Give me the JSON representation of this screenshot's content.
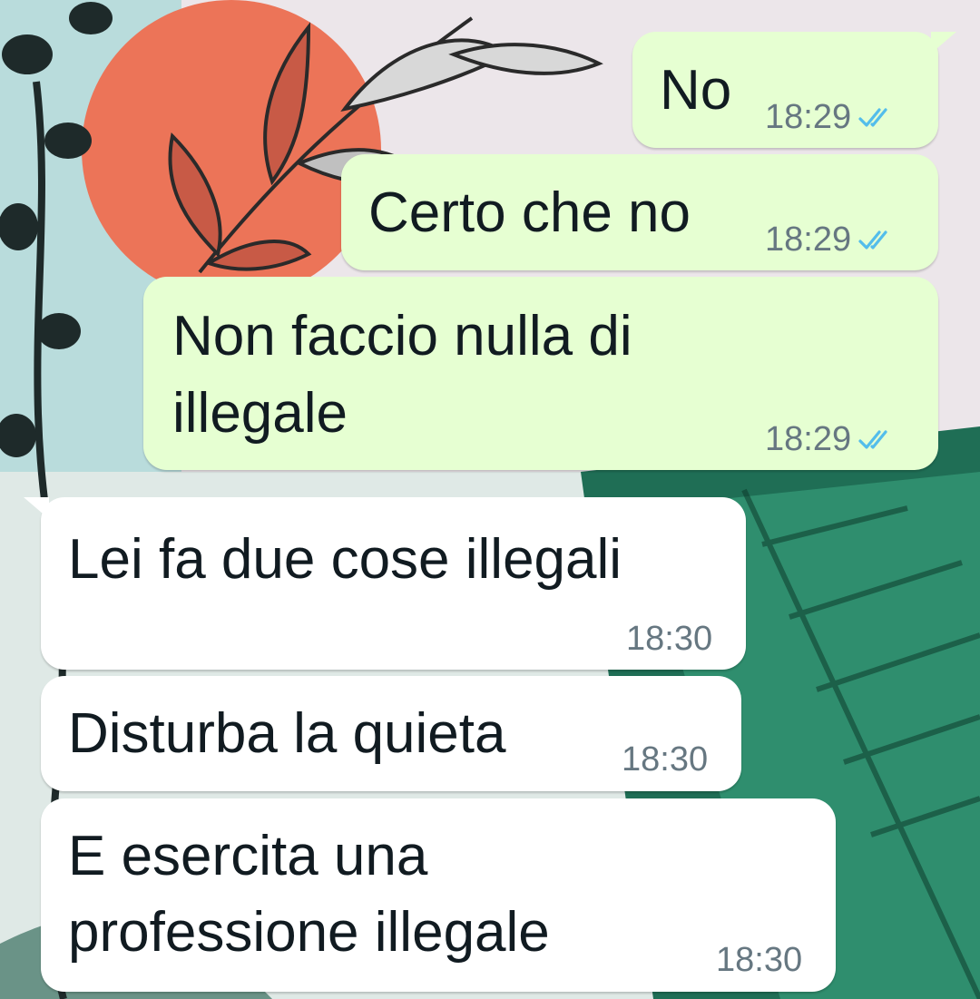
{
  "conversation": {
    "messages": [
      {
        "id": "m1",
        "direction": "outgoing",
        "text": "No",
        "time": "18:29",
        "status": "read"
      },
      {
        "id": "m2",
        "direction": "outgoing",
        "text": "Certo che no",
        "time": "18:29",
        "status": "read"
      },
      {
        "id": "m3",
        "direction": "outgoing",
        "lines": [
          "Non faccio nulla di",
          "illegale"
        ],
        "time": "18:29",
        "status": "read"
      },
      {
        "id": "m4",
        "direction": "incoming",
        "text": "Lei fa due cose illegali",
        "time": "18:30"
      },
      {
        "id": "m5",
        "direction": "incoming",
        "text": "Disturba la quieta",
        "time": "18:30"
      },
      {
        "id": "m6",
        "direction": "incoming",
        "lines": [
          "E esercita una",
          "professione illegale"
        ],
        "time": "18:30"
      }
    ]
  },
  "icons": {
    "read_receipt": "double-check-icon"
  },
  "colors": {
    "outgoing_bubble": "#e6ffd2",
    "incoming_bubble": "#ffffff",
    "text": "#111b21",
    "timestamp": "#667781",
    "read_tick": "#53bdeb",
    "wallpaper_orange": "#ec7458",
    "wallpaper_teal": "#1c7a5e",
    "wallpaper_sky": "#b7d9d9"
  }
}
